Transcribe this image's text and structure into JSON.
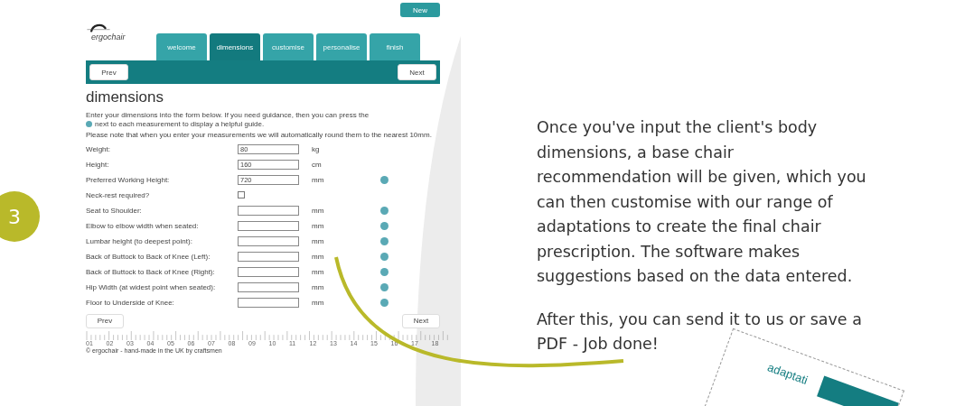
{
  "step_badge": "3",
  "app": {
    "new_button": "New",
    "logo": "ergochair",
    "tabs": [
      {
        "label": "welcome",
        "selected": false
      },
      {
        "label": "dimensions",
        "selected": true
      },
      {
        "label": "customise",
        "selected": false
      },
      {
        "label": "personalise",
        "selected": false
      },
      {
        "label": "finish",
        "selected": false
      }
    ],
    "prev_button": "Prev",
    "next_button": "Next",
    "heading": "dimensions",
    "intro_start": "Enter your dimensions into the form below. If you need guidance, then you can press the",
    "intro_end": "next to each measurement to display a helpful guide.",
    "note": "Please note that when you enter your measurements we will automatically round them to the nearest 10mm.",
    "fields": [
      {
        "kind": "input",
        "label": "Weight:",
        "value": "80",
        "unit": "kg",
        "help": false
      },
      {
        "kind": "input",
        "label": "Height:",
        "value": "160",
        "unit": "cm",
        "help": false
      },
      {
        "kind": "input",
        "label": "Preferred Working Height:",
        "value": "720",
        "unit": "mm",
        "help": true
      },
      {
        "kind": "checkbox",
        "label": "Neck-rest required?",
        "checked": false
      },
      {
        "kind": "input",
        "label": "Seat to Shoulder:",
        "unit": "mm",
        "help": true
      },
      {
        "kind": "input",
        "label": "Elbow to elbow width when seated:",
        "unit": "mm",
        "help": true
      },
      {
        "kind": "input",
        "label": "Lumbar height (to deepest point):",
        "unit": "mm",
        "help": true
      },
      {
        "kind": "input",
        "label": "Back of Buttock to Back of Knee (Left):",
        "unit": "mm",
        "help": true
      },
      {
        "kind": "input",
        "label": "Back of Buttock to Back of Knee (Right):",
        "unit": "mm",
        "help": true
      },
      {
        "kind": "input",
        "label": "Hip Width (at widest point when seated):",
        "unit": "mm",
        "help": true
      },
      {
        "kind": "input",
        "label": "Floor to Underside of Knee:",
        "unit": "mm",
        "help": true
      }
    ],
    "bottom_prev_button": "Prev",
    "bottom_next_button": "Next",
    "ruler_labels": [
      "01",
      "02",
      "03",
      "04",
      "05",
      "06",
      "07",
      "08",
      "09",
      "10",
      "11",
      "12",
      "13",
      "14",
      "15",
      "16",
      "17",
      "18"
    ],
    "footer": "© ergochair - hand-made in the UK by craftsmen"
  },
  "description": [
    [
      "Once you've input the client's body",
      "dimensions, a base chair",
      "recommendation will be given, which you",
      "can then customise with our range of",
      "adaptations to create the final chair",
      "prescription. The software makes",
      "suggestions based on the data entered."
    ],
    [
      "After this, you can send it to us or save a",
      "PDF - Job done!"
    ]
  ],
  "document_title": "adaptati"
}
